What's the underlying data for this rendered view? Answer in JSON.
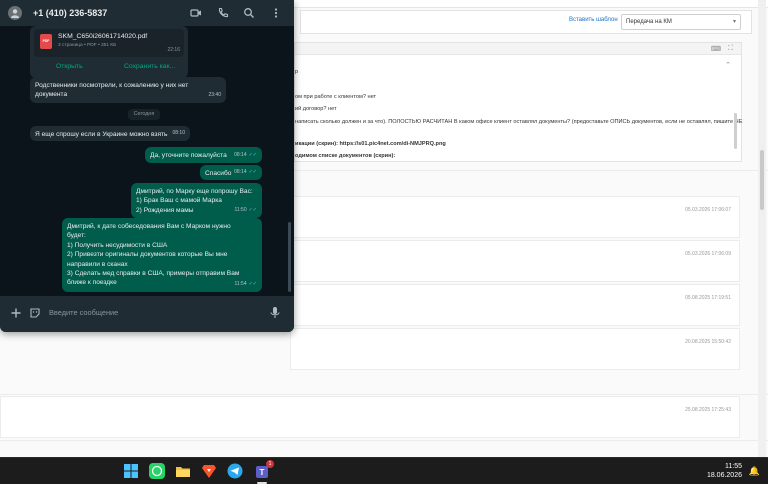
{
  "whatsapp": {
    "contact_name": "+1 (410) 236-5837",
    "header_icons": [
      "video-call-icon",
      "phone-icon",
      "search-icon",
      "more-vert-icon"
    ],
    "document": {
      "filename": "SKM_C650i26061714020.pdf",
      "meta": "3 страница • PDF • 351 КБ",
      "time": "22:16",
      "open_label": "Открыть",
      "save_label": "Сохранить как..."
    },
    "date_separator": "Сегодня",
    "messages": [
      {
        "dir": "in",
        "lines": [
          "Родственники посмотрели, к сожалению у них нет",
          "документа"
        ],
        "time": "23:40"
      },
      {
        "dir": "in",
        "lines": [
          "Я еще спрошу если в Украине можно взять"
        ],
        "time": "08:10"
      },
      {
        "dir": "out",
        "lines": [
          "Да, уточните пожалуйста"
        ],
        "time": "08:14"
      },
      {
        "dir": "out",
        "lines": [
          "Спасибо"
        ],
        "time": "08:14"
      },
      {
        "dir": "out",
        "lines": [
          "Дмитрий, по Марку еще попрошу Вас:",
          "1) Брак Ваш с мамой Марка",
          "2) Рождения мамы"
        ],
        "time": "11:50"
      },
      {
        "dir": "out",
        "lines": [
          "Дмитрий, к дате собеседования Вам с Марком нужно",
          "будет:",
          "1) Получить несудимости в США",
          "2) Привезти оригиналы документов которые Вы мне",
          "направили в сканах",
          "3) Сделать мед справки в США, примеры отправим Вам",
          "ближе к поездке"
        ],
        "time": "11:54"
      }
    ],
    "input_placeholder": "Введите сообщение",
    "colors": {
      "header": "#202c33",
      "background": "#0b141a",
      "outgoing": "#005c4b",
      "incoming": "#202c33",
      "accent": "#00a884"
    }
  },
  "crm": {
    "template_link": "Вставить шаблон",
    "status_select": "Передача на КМ",
    "lines": [
      "р",
      "ом при работе с клиентом? нет",
      "ий договор? нет",
      "написать сколько должен и за что). ПОЛОСТЬЮ РАСЧИТАН В каком офисе клиент оставлял документы? (предоставьте ОПИСЬ документов, если не оставлял, пишите НЕ",
      "икации (скрин): https://s01.pic4net.com/di-NMJPRQ.png",
      "одимом списке документов (скрин):"
    ],
    "timestamps": [
      "05.03.2026 17:06:07",
      "05.03.2026 17:06:09",
      "05.08.2025 17:19:51",
      "20.08.2025 15:50:42",
      "25.08.2025 17:25:43"
    ]
  },
  "taskbar": {
    "apps": [
      "windows-start-icon",
      "whatsapp-icon",
      "file-explorer-icon",
      "brave-browser-icon",
      "telegram-icon",
      "teams-icon"
    ],
    "badge": "1",
    "time": "11:55",
    "date": "18.06.2026"
  }
}
